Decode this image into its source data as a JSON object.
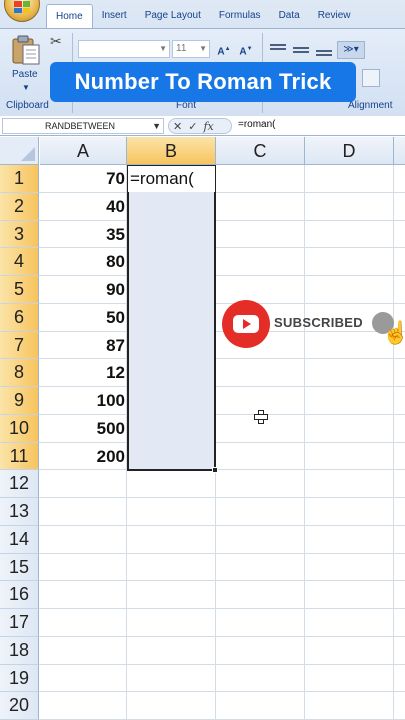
{
  "ribbon": {
    "tabs": [
      "Home",
      "Insert",
      "Page Layout",
      "Formulas",
      "Data",
      "Review"
    ],
    "active_tab": "Home",
    "paste_label": "Paste",
    "font_size": "11",
    "groups": [
      "Clipboard",
      "Font",
      "Alignment"
    ]
  },
  "banner": {
    "title": "Number To Roman Trick"
  },
  "formula_bar": {
    "name_box": "RANDBETWEEN",
    "formula": "=roman("
  },
  "grid": {
    "columns": [
      "A",
      "B",
      "C",
      "D"
    ],
    "rows": [
      "1",
      "2",
      "3",
      "4",
      "5",
      "6",
      "7",
      "8",
      "9",
      "10",
      "11",
      "12",
      "13",
      "14",
      "15",
      "16",
      "17",
      "18",
      "19",
      "20"
    ],
    "column_a_values": [
      "70",
      "40",
      "35",
      "80",
      "90",
      "50",
      "87",
      "12",
      "100",
      "500",
      "200"
    ],
    "active_cell_text": "=roman("
  },
  "overlay": {
    "subscribe_label": "SUBSCRIBED",
    "colors": {
      "youtube_red": "#e52d27",
      "banner_blue": "#1877e6"
    }
  }
}
